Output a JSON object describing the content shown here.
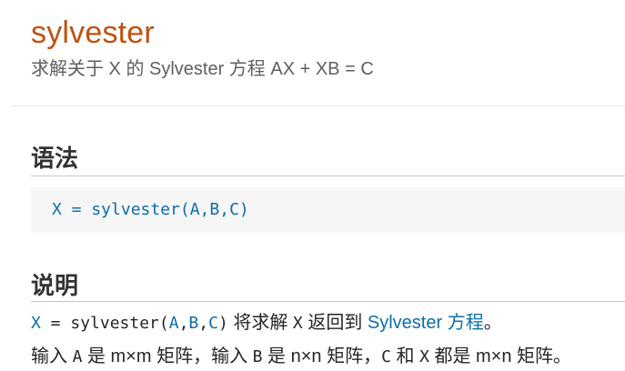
{
  "header": {
    "title": "sylvester",
    "subtitle": "求解关于 X 的 Sylvester 方程 AX + XB = C"
  },
  "syntax": {
    "heading": "语法",
    "code": "X = sylvester(A,B,C)"
  },
  "description": {
    "heading": "说明",
    "line1": {
      "output": "X",
      "equals": " = sylvester(",
      "a": "A",
      "comma1": ",",
      "b": "B",
      "comma2": ",",
      "c": "C",
      "close": ")",
      "text_before_var": " 将求解 ",
      "var": "X",
      "text_before_link": " 返回到 ",
      "link": "Sylvester 方程",
      "period": "。"
    },
    "line2": {
      "p1": "输入 ",
      "a": "A",
      "p2": " 是 m×m 矩阵，输入 ",
      "b": "B",
      "p3": " 是 n×n 矩阵，",
      "c": "C",
      "p4": " 和 ",
      "x": "X",
      "p5": " 都是 m×n 矩阵。"
    }
  },
  "colors": {
    "title": "#c05010",
    "link": "#0b6fa8",
    "code_background": "#f6f6f6"
  }
}
